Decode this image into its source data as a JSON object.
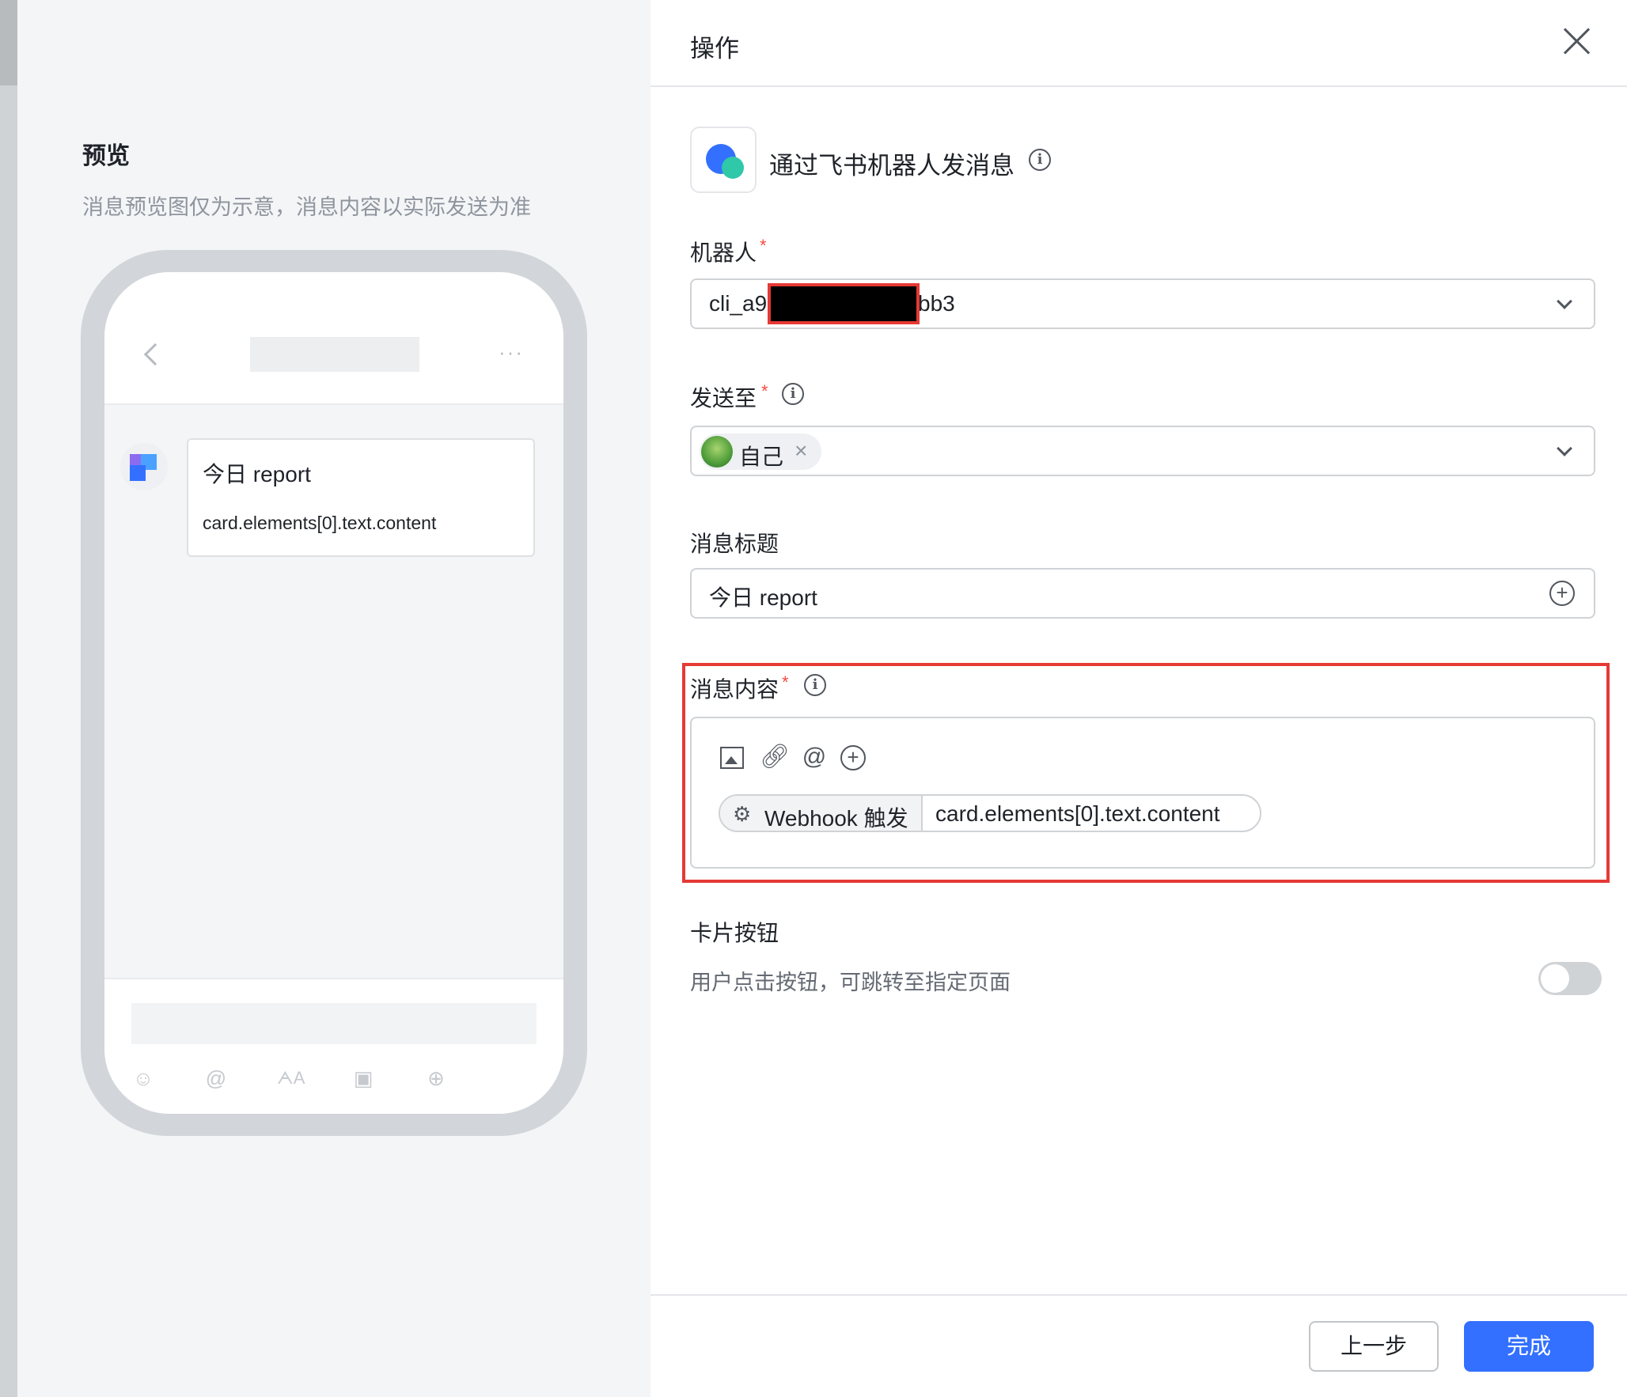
{
  "preview": {
    "title": "预览",
    "subtitle": "消息预览图仅为示意，消息内容以实际发送为准",
    "phone": {
      "more": "···",
      "message_title": "今日 report",
      "message_content": "card.elements[0].text.content",
      "toolbar_icons": [
        "emoji-icon",
        "mention-icon",
        "text-format-icon",
        "image-icon",
        "plus-icon"
      ]
    }
  },
  "panel": {
    "title": "操作",
    "action_title": "通过飞书机器人发消息",
    "fields": {
      "robot": {
        "label": "机器人",
        "required": "*",
        "value_prefix": "cli_a9",
        "value_suffix": "bb3"
      },
      "send_to": {
        "label": "发送至",
        "required": "*",
        "chip_label": "自己",
        "chip_remove": "×"
      },
      "message_title": {
        "label": "消息标题",
        "value": "今日 report"
      },
      "message_content": {
        "label": "消息内容",
        "required": "*",
        "toolbar": [
          "image-icon",
          "link-icon",
          "mention-icon",
          "plus-circle-icon"
        ],
        "variable_source": "Webhook 触发",
        "variable_path": "card.elements[0].text.content"
      },
      "card_button": {
        "label": "卡片按钮",
        "description": "用户点击按钮，可跳转至指定页面",
        "enabled": false
      }
    },
    "footer": {
      "prev_label": "上一步",
      "done_label": "完成"
    },
    "colors": {
      "primary": "#3370ff",
      "required": "#f54a45",
      "highlight": "#e53935"
    }
  }
}
